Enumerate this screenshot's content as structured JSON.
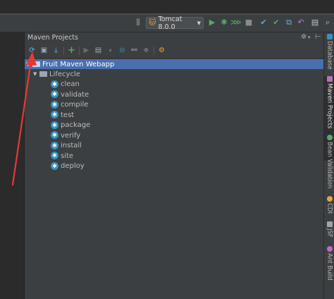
{
  "toolbar": {
    "run_config_label": "Tomcat 8.0.0",
    "icons": [
      "structure-icon",
      "tomcat-icon",
      "run-icon",
      "debug-icon",
      "coverage-icon",
      "stop-icon",
      "vcs-update-icon",
      "vcs-commit-icon",
      "vcs-compare-icon",
      "undo-icon",
      "project-structure-icon",
      "search-icon"
    ]
  },
  "panel": {
    "title": "Maven Projects",
    "header_icons": [
      "gear-icon",
      "hide-icon"
    ],
    "toolbar_icons": [
      "reimport-icon",
      "generate-sources-icon",
      "download-icon",
      "add-icon",
      "run-maven-build-icon",
      "execute-goal-icon",
      "toggle-offline-icon",
      "skip-tests-icon",
      "show-dependencies-icon",
      "collapse-all-icon",
      "maven-settings-icon"
    ]
  },
  "tree": {
    "root": "Fruit Maven Webapp",
    "lifecycle_label": "Lifecycle",
    "goals": [
      "clean",
      "validate",
      "compile",
      "test",
      "package",
      "verify",
      "install",
      "site",
      "deploy"
    ]
  },
  "right_tabs": [
    "Database",
    "Maven Projects",
    "Bean Validation",
    "CDI",
    "JSF",
    "Ant Build"
  ],
  "colors": {
    "selection": "#4b6eaf",
    "goal_icon": "#3592c4",
    "annotation_arrow": "#e53935",
    "run_green": "#59a869"
  }
}
